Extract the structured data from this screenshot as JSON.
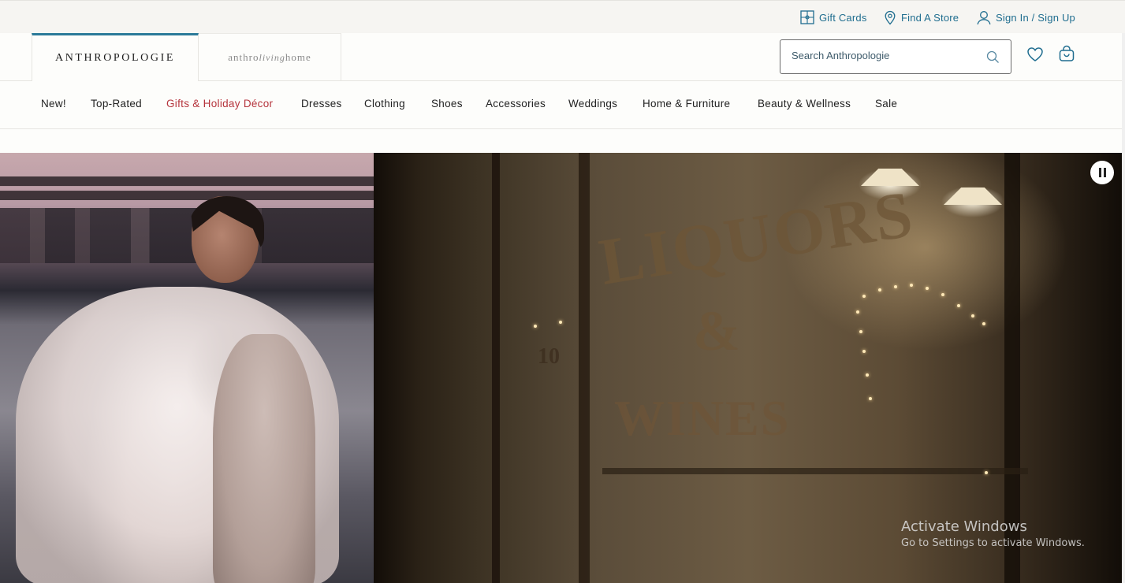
{
  "utility": {
    "gift_cards": "Gift Cards",
    "find_store": "Find A Store",
    "sign_in": "Sign In / Sign Up"
  },
  "header": {
    "brand_main": "ANTHROPOLOGIE",
    "brand_sub_a": "anthro",
    "brand_sub_b": "living",
    "brand_sub_c": "home",
    "search_placeholder": "Search Anthropologie",
    "accent_color": "#2b7a99"
  },
  "nav": {
    "items": [
      {
        "label": "New!"
      },
      {
        "label": "Top-Rated"
      },
      {
        "label": "Gifts & Holiday Décor",
        "highlight_color": "#b5343c"
      },
      {
        "label": "Dresses"
      },
      {
        "label": "Clothing"
      },
      {
        "label": "Shoes"
      },
      {
        "label": "Accessories"
      },
      {
        "label": "Weddings"
      },
      {
        "label": "Home & Furniture"
      },
      {
        "label": "Beauty & Wellness"
      },
      {
        "label": "Sale"
      }
    ]
  },
  "hero": {
    "sign_liquors": "LIQUORS",
    "sign_amp": "&",
    "sign_wines": "WINES",
    "sign_number": "10",
    "pause_icon": "pause-icon"
  },
  "watermark": {
    "title": "Activate Windows",
    "subtitle": "Go to Settings to activate Windows."
  }
}
